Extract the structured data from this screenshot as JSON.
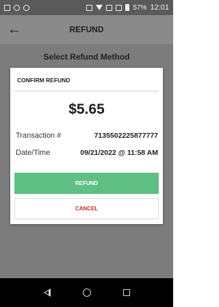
{
  "status_bar": {
    "battery": "57%",
    "time": "12:01"
  },
  "app_bar": {
    "back_icon": "arrow-left-icon",
    "title": "REFUND"
  },
  "background": {
    "heading": "Select Refund Method"
  },
  "dialog": {
    "title": "CONFIRM REFUND",
    "amount": "$5.65",
    "transaction_label": "Transaction #",
    "transaction_value": "7135502225877777",
    "datetime_label": "Date/Time",
    "datetime_value": "09/21/2022 @ 11:58 AM",
    "refund_button": "REFUND",
    "cancel_button": "CANCEL"
  },
  "colors": {
    "refund_green": "#5fbf85",
    "cancel_red": "#d22b2b"
  }
}
